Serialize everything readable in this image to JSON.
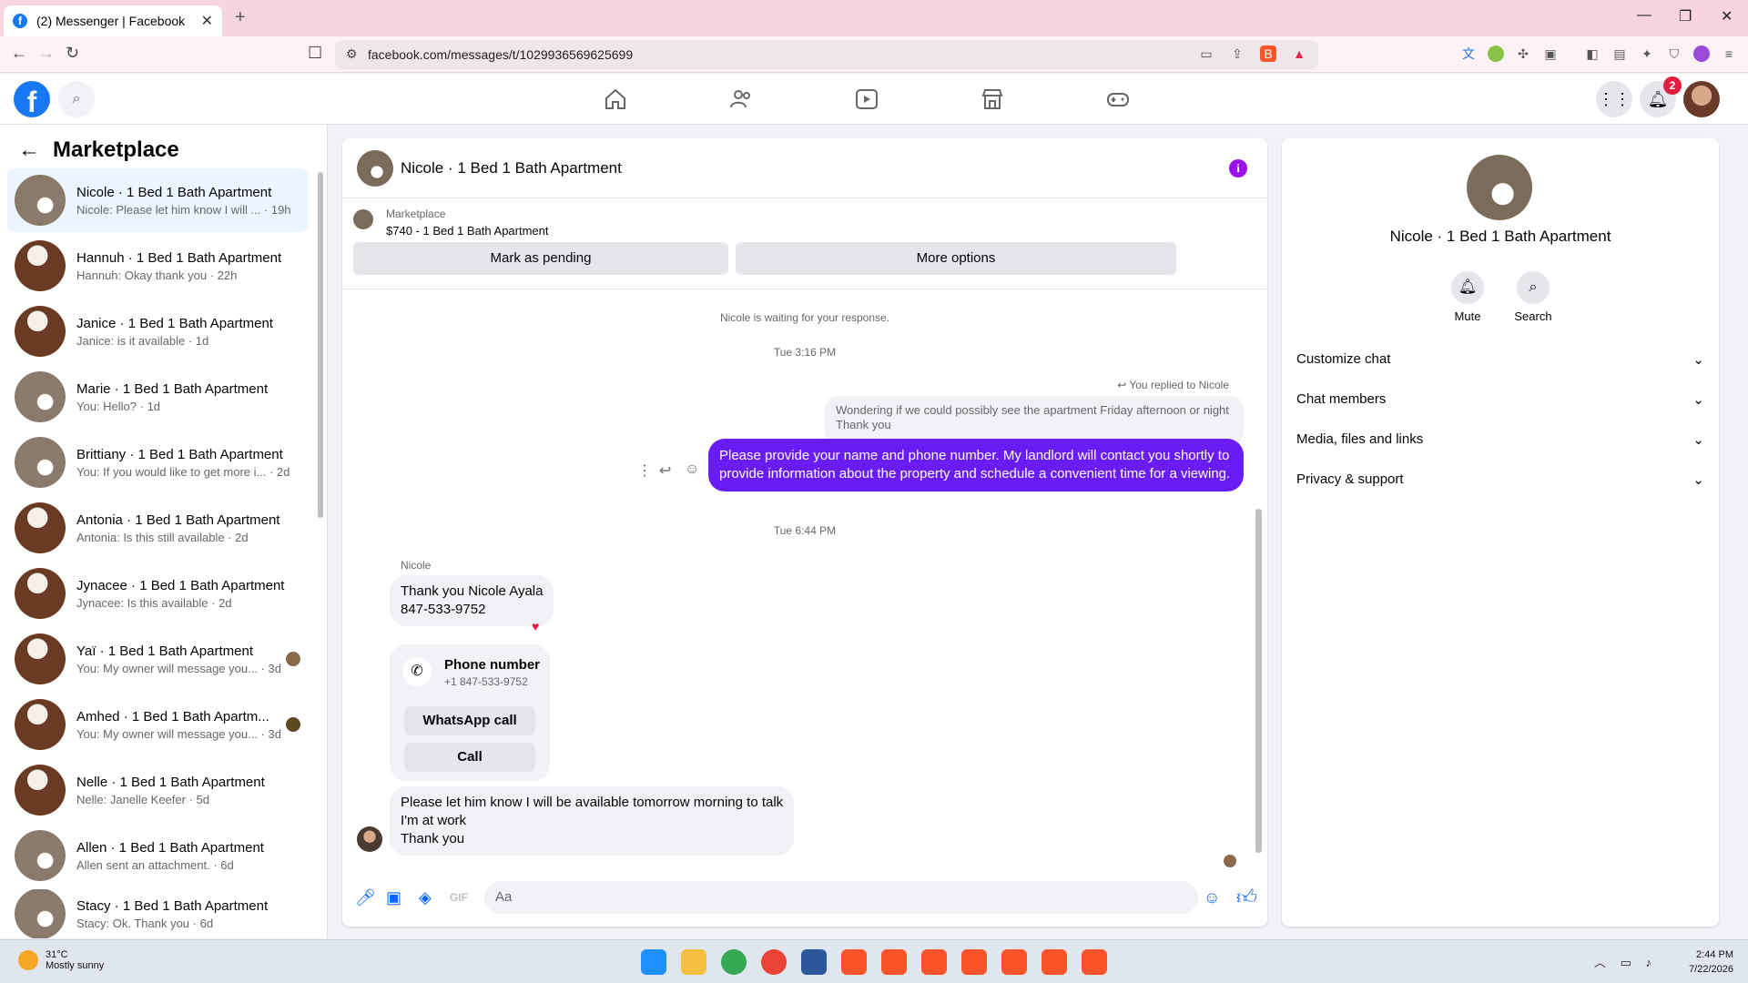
{
  "browser": {
    "tab_title": "(2) Messenger | Facebook",
    "url": "facebook.com/messages/t/1029936569625699"
  },
  "left": {
    "title": "Marketplace",
    "conversations": [
      {
        "name": "Nicole · 1 Bed 1 Bath Apartment",
        "preview": "Nicole: Please let him know I will ... · 19h"
      },
      {
        "name": "Hannuh · 1 Bed 1 Bath Apartment",
        "preview": "Hannuh: Okay thank you · 22h"
      },
      {
        "name": "Janice · 1 Bed 1 Bath Apartment",
        "preview": "Janice: is it available · 1d"
      },
      {
        "name": "Marie · 1 Bed 1 Bath Apartment",
        "preview": "You: Hello? · 1d"
      },
      {
        "name": "Brittiany · 1 Bed 1 Bath Apartment",
        "preview": "You: If you would like to get more i... · 2d"
      },
      {
        "name": "Antonia · 1 Bed 1 Bath Apartment",
        "preview": "Antonia: Is this still available · 2d"
      },
      {
        "name": "Jynacee · 1 Bed 1 Bath Apartment",
        "preview": "Jynacee: Is this available · 2d"
      },
      {
        "name": "Yaï · 1 Bed 1 Bath Apartment",
        "preview": "You: My owner will message you... · 3d"
      },
      {
        "name": "Amhed · 1 Bed 1 Bath Apartm...",
        "preview": "You: My owner will message you... · 3d"
      },
      {
        "name": "Nelle · 1 Bed 1 Bath Apartment",
        "preview": "Nelle: Janelle Keefer · 5d"
      },
      {
        "name": "Allen · 1 Bed 1 Bath Apartment",
        "preview": "Allen sent an attachment. · 6d"
      },
      {
        "name": "Stacy · 1 Bed 1 Bath Apartment",
        "preview": "Stacy: Ok. Thank you · 6d"
      }
    ]
  },
  "chat": {
    "title": "Nicole · 1 Bed 1 Bath Apartment",
    "marketplace_label": "Marketplace",
    "listing": "$740 - 1 Bed 1 Bath Apartment",
    "mark_pending": "Mark as pending",
    "more_options": "More options",
    "waiting": "Nicole is waiting for your response.",
    "time1": "Tue 3:16 PM",
    "replied_to": "You replied to Nicole",
    "quoted": "Wondering if we could possibly see the apartment Friday afternoon or night Thank you",
    "outgoing": "Please provide your name and phone number. My landlord will contact you shortly to provide information about the property and schedule a convenient time for a viewing.",
    "time2": "Tue 6:44 PM",
    "sender": "Nicole",
    "msg1_line1": "Thank you Nicole Ayala",
    "msg1_line2": "847-533-9752",
    "phone_title": "Phone number",
    "phone_number": "+1 847-533-9752",
    "whatsapp_call": "WhatsApp call",
    "call": "Call",
    "msg2_line1": "Please let him know I will be available tomorrow morning to talk",
    "msg2_line2": "I'm at work",
    "msg2_line3": "Thank you",
    "composer_placeholder": "Aa"
  },
  "right": {
    "name": "Nicole · 1 Bed 1 Bath Apartment",
    "mute": "Mute",
    "search": "Search",
    "sections": [
      "Customize chat",
      "Chat members",
      "Media, files and links",
      "Privacy & support"
    ]
  },
  "header": {
    "notification_count": "2"
  },
  "taskbar": {
    "temp": "31°C",
    "weather": "Mostly sunny",
    "time": "2:44 PM",
    "date": "7/22/2026"
  },
  "colors": {
    "accent": "#1877f2",
    "outgoing_bubble": "#6a1cf5",
    "tabbar": "#f8d5de"
  }
}
